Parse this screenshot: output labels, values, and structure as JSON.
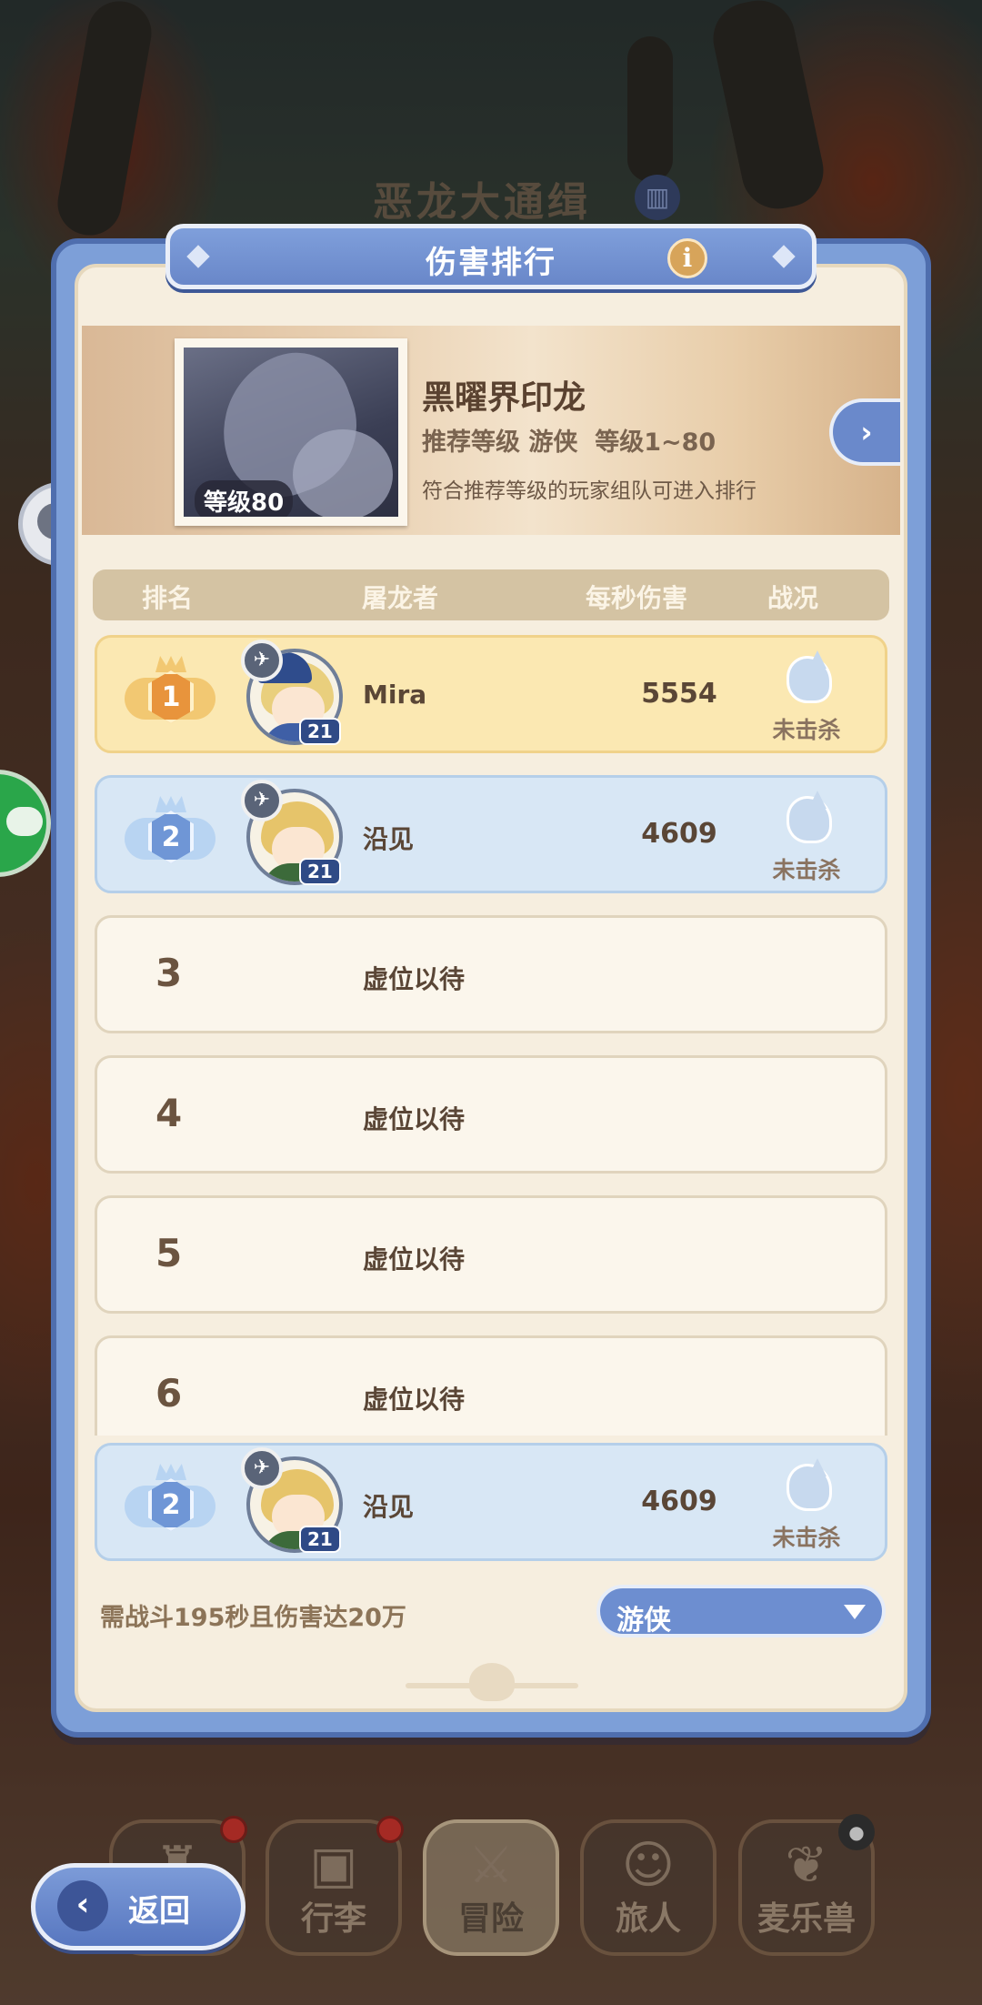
{
  "background": {
    "title": "恶龙大通缉",
    "title_icon": "book-icon"
  },
  "panel": {
    "title": "伤害排行",
    "info_icon": "i"
  },
  "boss": {
    "name": "黑曜界印龙",
    "level_badge": "等级80",
    "recommendation": "推荐等级 游侠  等级1~80",
    "note": "符合推荐等级的玩家组队可进入排行",
    "next_icon": "chevron-right-icon"
  },
  "table": {
    "headers": {
      "rank": "排名",
      "slayer": "屠龙者",
      "dps": "每秒伤害",
      "status": "战况"
    },
    "rows": [
      {
        "rank": "1",
        "name": "Mira",
        "level": "21",
        "dps": "5554",
        "status": "未击杀",
        "tier": "gold"
      },
      {
        "rank": "2",
        "name": "沿见",
        "level": "21",
        "dps": "4609",
        "status": "未击杀",
        "tier": "silver"
      },
      {
        "rank": "3",
        "placeholder": "虚位以待"
      },
      {
        "rank": "4",
        "placeholder": "虚位以待"
      },
      {
        "rank": "5",
        "placeholder": "虚位以待"
      },
      {
        "rank": "6",
        "placeholder": "虚位以待"
      }
    ],
    "self_row": {
      "rank": "2",
      "name": "沿见",
      "level": "21",
      "dps": "4609",
      "status": "未击杀"
    }
  },
  "footer": {
    "requirement": "需战斗195秒且伤害达20万",
    "class_filter": "游侠"
  },
  "nav": {
    "back_label": "返回",
    "items": [
      {
        "label": "",
        "icon": "castle-icon"
      },
      {
        "label": "行李",
        "icon": "chest-icon"
      },
      {
        "label": "冒险",
        "icon": "crossed-swords-icon"
      },
      {
        "label": "旅人",
        "icon": "traveler-icon"
      },
      {
        "label": "麦乐兽",
        "icon": "creature-icon"
      }
    ]
  },
  "colors": {
    "panel_blue": "#7d9fd8",
    "gold_row": "#fbe8b2",
    "blue_row": "#d8e7f5",
    "cream": "#f6eedf"
  }
}
